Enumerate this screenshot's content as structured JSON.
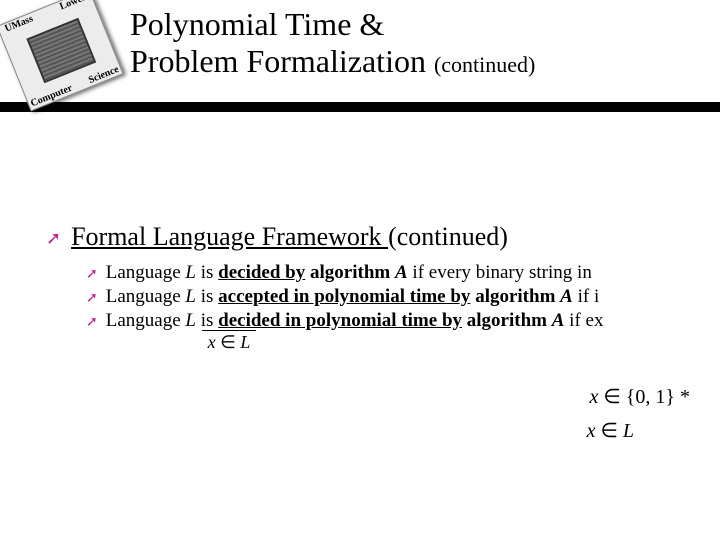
{
  "logo": {
    "t1": "UMass",
    "t2": "Lowell",
    "t3": "Science",
    "t4": "Computer"
  },
  "title": {
    "line1": "Polynomial Time &",
    "line2_main": "Problem Formalization ",
    "line2_cont": "(continued)"
  },
  "section": {
    "heading_u": "Formal Language Framework ",
    "heading_rest": "(continued)"
  },
  "bullets": {
    "b1_a": "Language ",
    "b1_L": "L",
    "b1_b": " is ",
    "b1_key": "decided by",
    "b1_c": " algorithm ",
    "b1_A": "A",
    "b1_d": " if every binary string in ",
    "b2_a": "Language ",
    "b2_L": "L",
    "b2_b": " is ",
    "b2_key": "accepted in polynomial time by",
    "b2_c": " algorithm ",
    "b2_A": "A",
    "b2_d": " if i",
    "b3_a": "Language ",
    "b3_L": "L",
    "b3_b": " is ",
    "b3_key": "decided in polynomial time by",
    "b3_c": " algorithm ",
    "b3_A": "A",
    "b3_d": " if ex"
  },
  "math": {
    "inline_x": "x",
    "inline_in": " ∈ ",
    "inline_L": "L",
    "m1_x": "x",
    "m1_in": " ∈ ",
    "m1_set": "{0, 1}",
    "m1_star": " *",
    "m2_x": "x",
    "m2_in": " ∈ ",
    "m2_L": "L"
  }
}
